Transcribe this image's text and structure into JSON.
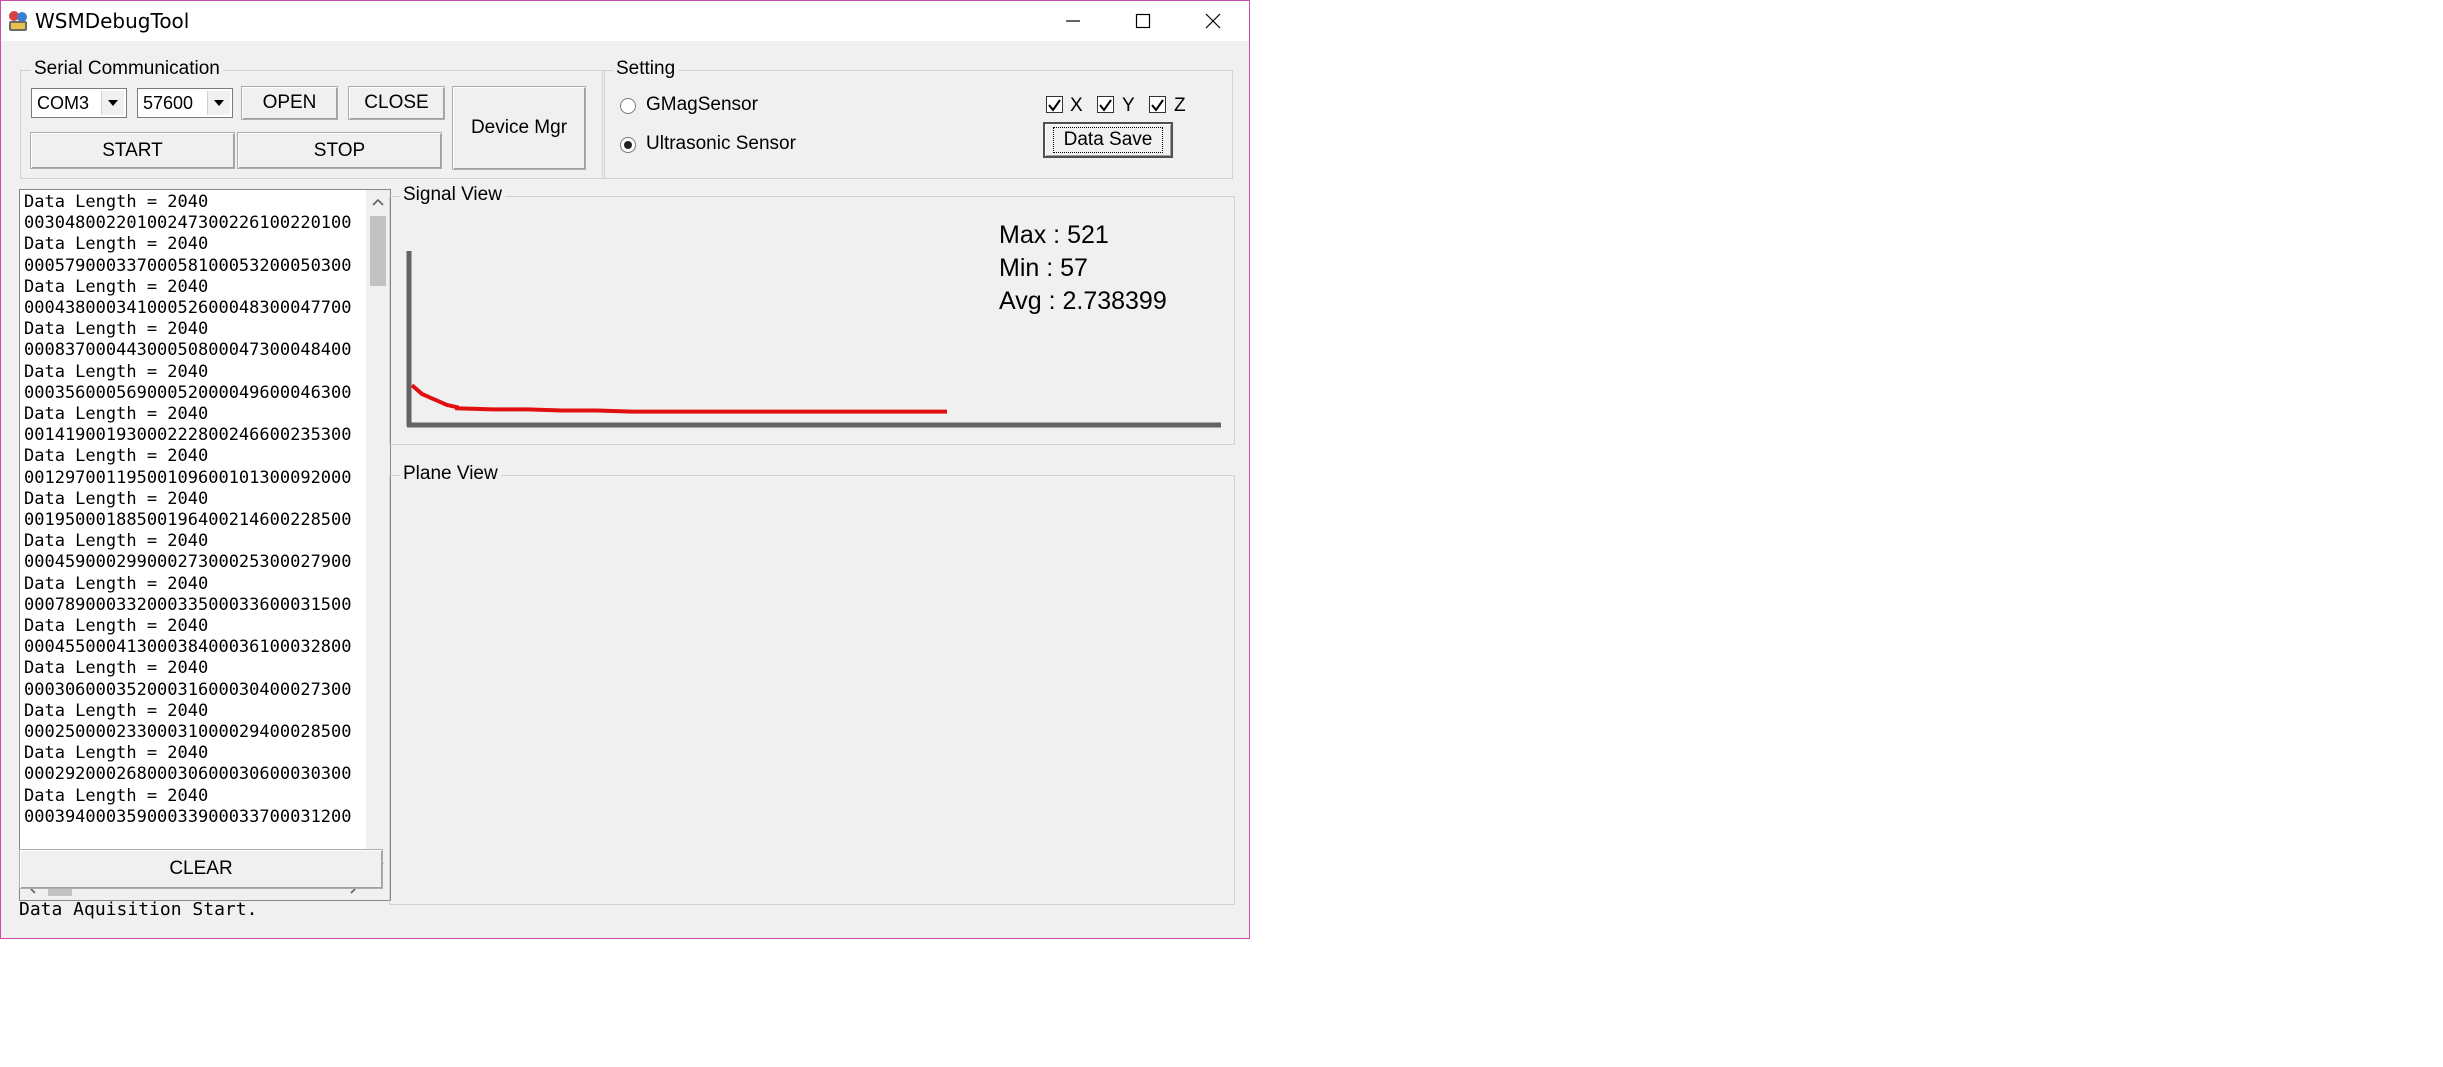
{
  "window": {
    "title": "WSMDebugTool"
  },
  "serial": {
    "group_label": "Serial Communication",
    "port_value": "COM3",
    "baud_value": "57600",
    "open_label": "OPEN",
    "close_label": "CLOSE",
    "start_label": "START",
    "stop_label": "STOP",
    "device_mgr_label": "Device Mgr"
  },
  "setting": {
    "group_label": "Setting",
    "radio_gmag": {
      "label": "GMagSensor",
      "checked": false
    },
    "radio_ultrasonic": {
      "label": "Ultrasonic Sensor",
      "checked": true
    },
    "check_x": {
      "label": "X",
      "checked": true
    },
    "check_y": {
      "label": "Y",
      "checked": true
    },
    "check_z": {
      "label": "Z",
      "checked": true
    },
    "data_save_label": "Data Save"
  },
  "log": {
    "lines": [
      "Data Length = 2040",
      "00304800220100247300226100220100",
      "Data Length = 2040",
      "00057900033700058100053200050300",
      "Data Length = 2040",
      "00043800034100052600048300047700",
      "Data Length = 2040",
      "00083700044300050800047300048400",
      "Data Length = 2040",
      "00035600056900052000049600046300",
      "Data Length = 2040",
      "00141900193000222800246600235300",
      "Data Length = 2040",
      "00129700119500109600101300092000",
      "Data Length = 2040",
      "00195000188500196400214600228500",
      "Data Length = 2040",
      "00045900029900027300025300027900",
      "Data Length = 2040",
      "00078900033200033500033600031500",
      "Data Length = 2040",
      "00045500041300038400036100032800",
      "Data Length = 2040",
      "00030600035200031600030400027300",
      "Data Length = 2040",
      "00025000023300031000029400028500",
      "Data Length = 2040",
      "00029200026800030600030600030300",
      "Data Length = 2040",
      "00039400035900033900033700031200"
    ],
    "clear_label": "CLEAR"
  },
  "signal_view": {
    "group_label": "Signal View",
    "max_text": "Max : 521",
    "min_text": "Min : 57",
    "avg_text": "Avg : 2.738399",
    "line_color": "#e01010",
    "axis_color": "#646464",
    "trace": [
      14,
      12,
      10,
      9,
      8,
      7,
      6,
      5,
      4.5,
      4,
      3.5,
      3,
      3,
      2.5,
      2.5,
      2,
      2,
      2,
      2,
      2,
      2,
      2,
      2,
      2,
      2
    ]
  },
  "plane_view": {
    "group_label": "Plane View"
  },
  "status_bar": {
    "text": "Data Aquisition Start."
  }
}
